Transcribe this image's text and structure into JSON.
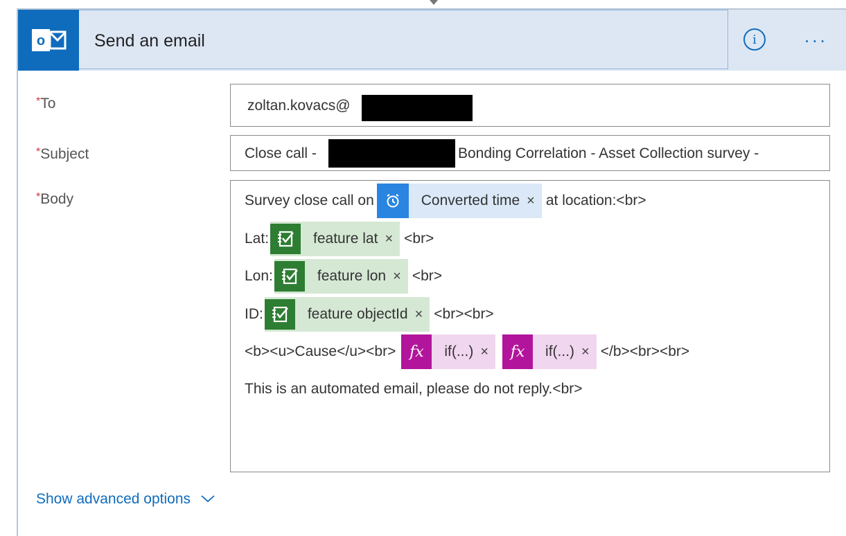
{
  "header": {
    "title": "Send an email",
    "logo_icon": "outlook-icon",
    "info_label": "i",
    "more_label": "..."
  },
  "fields": {
    "required_mark": "*",
    "to_label": "To",
    "to_value": "zoltan.kovacs@",
    "subject_label": "Subject",
    "subject_prefix": "Close call -",
    "subject_suffix": "Bonding Correlation - Asset Collection survey -",
    "body_label": "Body"
  },
  "body": {
    "line1_pre": "Survey close call on",
    "token_time": "Converted time",
    "line1_post": "at location:<br>",
    "lat_label": "Lat:",
    "token_lat": "feature lat",
    "lat_post": "<br>",
    "lon_label": "Lon:",
    "token_lon": "feature lon",
    "lon_post": "<br>",
    "id_label": "ID:",
    "token_id": "feature objectId",
    "id_post": "<br><br>",
    "cause_pre": "<b><u>Cause</u><br>",
    "token_if1": "if(...)",
    "token_if2": "if(...)",
    "cause_post": "</b><br><br>",
    "footer_line": "This is an automated email, please do not reply.<br>",
    "remove_glyph": "×",
    "fx_glyph": "fx"
  },
  "advanced": {
    "label": "Show advanced options"
  },
  "colors": {
    "accent": "#0f6cbd",
    "header_bg": "#dde7f3",
    "required": "#d13438",
    "time_token": "#2a85e0",
    "survey_token": "#2d7d32",
    "expression_token": "#b2159b"
  }
}
